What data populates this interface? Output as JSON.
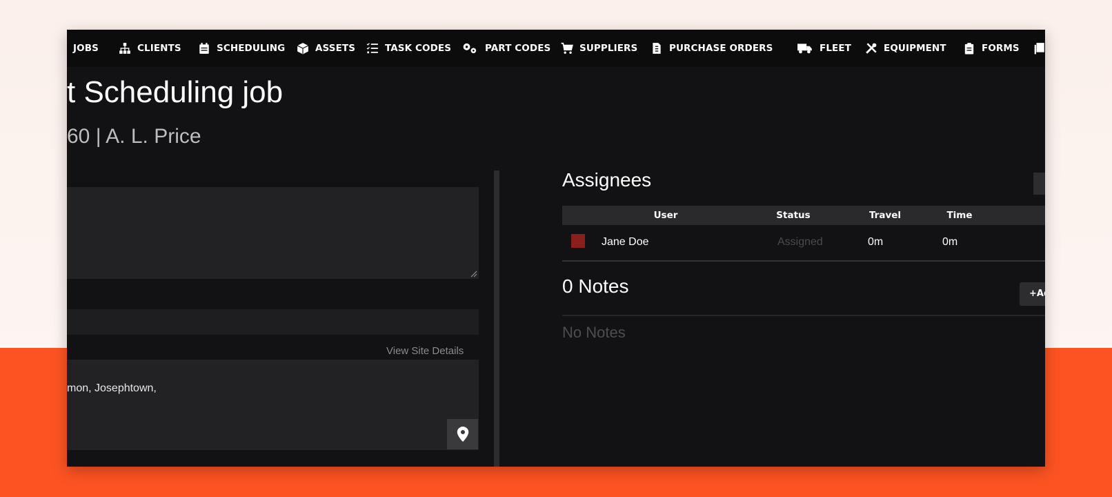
{
  "nav": {
    "items": [
      {
        "label": "JOBS",
        "icon": "house-icon"
      },
      {
        "label": "CLIENTS",
        "icon": "sitemap-icon"
      },
      {
        "label": "SCHEDULING",
        "icon": "calendar-icon"
      },
      {
        "label": "ASSETS",
        "icon": "cube-icon"
      },
      {
        "label": "TASK CODES",
        "icon": "checklist-icon"
      },
      {
        "label": "PART CODES",
        "icon": "gears-icon"
      },
      {
        "label": "SUPPLIERS",
        "icon": "cart-icon"
      },
      {
        "label": "PURCHASE ORDERS",
        "icon": "invoice-icon"
      },
      {
        "label": "FLEET",
        "icon": "truck-icon"
      },
      {
        "label": "EQUIPMENT",
        "icon": "tools-icon"
      },
      {
        "label": "FORMS",
        "icon": "clipboard-icon"
      }
    ]
  },
  "job": {
    "title": "st Scheduling job",
    "subtitle": "60 | A. L. Price"
  },
  "site": {
    "view_site_details": "View Site Details",
    "address": "mon, Josephtown,"
  },
  "assignees": {
    "title": "Assignees",
    "columns": [
      "User",
      "Status",
      "Travel",
      "Time"
    ],
    "rows": [
      {
        "user": "Jane Doe",
        "status": "Assigned",
        "travel": "0m",
        "time": "0m",
        "color": "#8a1f1b"
      }
    ]
  },
  "notes": {
    "title": "0 Notes",
    "add_label": "+Add",
    "empty_text": "No Notes"
  },
  "colors": {
    "brand_orange": "#fd5322",
    "app_background": "#121214"
  }
}
